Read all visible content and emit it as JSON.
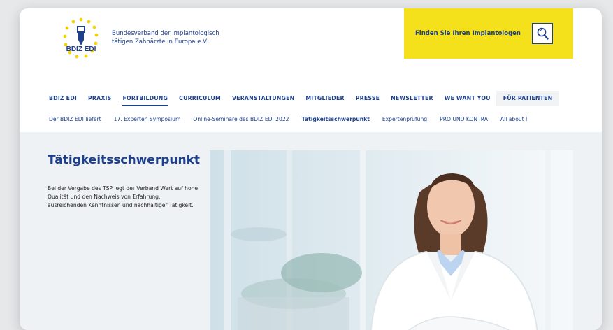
{
  "header": {
    "logo_text": "BDIZ EDI",
    "org_name_line1": "Bundesverband der implantologisch",
    "org_name_line2": "tätigen Zahnärzte in Europa e.V.",
    "finder_label": "Finden Sie Ihren Implantologen",
    "finder_icon": "magnifier-icon"
  },
  "mainnav": [
    {
      "label": "BDIZ EDI"
    },
    {
      "label": "PRAXIS"
    },
    {
      "label": "FORTBILDUNG"
    },
    {
      "label": "CURRICULUM"
    },
    {
      "label": "VERANSTALTUNGEN"
    },
    {
      "label": "MITGLIEDER"
    },
    {
      "label": "PRESSE"
    },
    {
      "label": "NEWSLETTER"
    },
    {
      "label": "WE WANT YOU"
    },
    {
      "label": "FÜR PATIENTEN"
    }
  ],
  "subnav": [
    {
      "label": "Der BDIZ EDI liefert"
    },
    {
      "label": "17. Experten Symposium"
    },
    {
      "label": "Online-Seminare des BDIZ EDI 2022"
    },
    {
      "label": "Tätigkeitsschwerpunkt"
    },
    {
      "label": "Expertenprüfung"
    },
    {
      "label": "PRO UND KONTRA"
    },
    {
      "label": "All about I"
    }
  ],
  "main": {
    "title": "Tätigkeitsschwerpunkt",
    "intro": "Bei der Vergabe des TSP legt der Verband Wert auf hohe Qualität und den Nachweis von Erfahrung, ausreichenden Kenntnissen und nachhaltiger Tätigkeit."
  },
  "colors": {
    "brand_blue": "#1d3f8c",
    "accent_yellow": "#f4e11c",
    "content_bg": "#eef2f4"
  }
}
